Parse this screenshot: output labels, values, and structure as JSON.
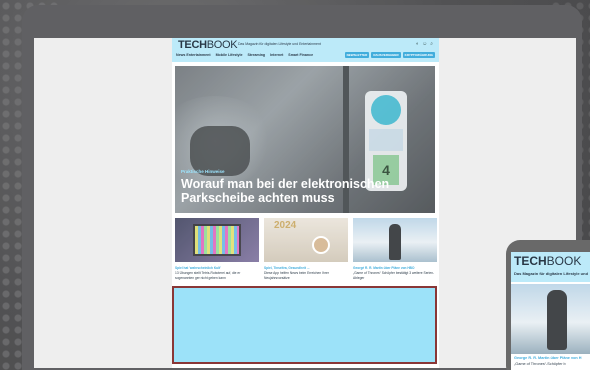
{
  "site": {
    "logo_bold": "TECH",
    "logo_thin": "BOOK",
    "tagline": "Das Magazin für digitalen Lifestyle und Entertainment",
    "nav": [
      "News Entertainment",
      "Mobile Lifestyle",
      "Streaming",
      "Internet",
      "Smart Finance"
    ],
    "nav_buttons": [
      "NEWSLETTER",
      "RAUSVERGEBER",
      "KRYPTOWÄHRUNG"
    ],
    "header_icons": [
      "theme-toggle-icon",
      "account-icon",
      "search-icon"
    ]
  },
  "hero": {
    "kicker": "Praktische Hinweise",
    "title": "Worauf man bei der elektronischen Parkscheibe achten muss",
    "disc_number": "4"
  },
  "cards": [
    {
      "kicker": "Spiel hat 'wahrscheinlich Kult'",
      "title": "13 Übungen stellt Tetris-Roboterei auf, die er sogenannten ger nicht geben kann"
    },
    {
      "kicker": "Spiel, Tinseltra, Gesundheit ...",
      "title": "Diese App helfen News beim Erreichen Ihrer Neujahrsvorsätze"
    },
    {
      "kicker": "Georgé R. R. Martin über Pläne von HBO",
      "title": "„Game of Thrones“ Schöpfer bestätigt 3 weitere Serien-Ableger"
    }
  ],
  "phone": {
    "logo_bold": "TECH",
    "logo_thin": "BOOK",
    "tagline": "Das Magazin für digitalen Lifestyle und",
    "kicker": "George R. R. Martin über Pläne von H",
    "title": "„Game of Thrones“-Schöpfer b"
  },
  "colors": {
    "brand_light_blue": "#b3e7f9",
    "accent_blue": "#27a2d8",
    "ad_fill": "#8fdff9",
    "ad_border": "#7a1c1c"
  }
}
